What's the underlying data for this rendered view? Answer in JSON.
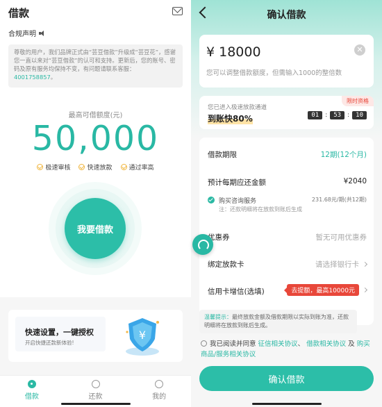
{
  "left": {
    "title": "借款",
    "compliance_label": "合规声明",
    "notice_text": "尊敬的用户，我们品牌正式由“芸豆借款”升级成“芸豆花”，感谢您一直以来对“芸豆借款”的认可和支持。更新后，您的账号、密码及原有服务均保持不变，有问题请联系客服：",
    "notice_phone": "4001758857",
    "notice_end": "。",
    "max_limit_label": "最高可借额度(元)",
    "max_limit_amount": "50,000",
    "features": [
      "极速审核",
      "快速放款",
      "通过率高"
    ],
    "borrow_button": "我要借款",
    "promo_title": "快速设置，一键授权",
    "promo_subtitle": "开启快捷还款新体验!",
    "tabs": [
      "借款",
      "还款",
      "我的"
    ]
  },
  "right": {
    "title": "确认借款",
    "amount": "¥ 18000",
    "amount_hint": "您可以调整借款额度，但需输入1000的整倍数",
    "limited_badge": "限时资格",
    "channel_text": "您已进入极速放款通道",
    "fast_text": "到账快80%",
    "timer": [
      "01",
      "53",
      "10"
    ],
    "term_label": "借款期限",
    "term_value": "12期(12个月)",
    "repay_label": "预计每期应还金额",
    "repay_value": "¥2040",
    "consult_label": "购买咨询服务",
    "consult_value": "231.68元/期(共12期)",
    "consult_note": "注：还款明细将在放款到账后生成",
    "coupon_label": "优惠券",
    "coupon_value": "暂无可用优惠券",
    "card_label": "绑定放款卡",
    "card_value": "请选择银行卡",
    "credit_label": "信用卡增信(选填)",
    "credit_tag": "去提额，最高10000元",
    "warm_label": "温馨提示：",
    "warm_text": "最终放款金额及借款期限以实际到账为准，还款明细将在放款到账后生成。",
    "agree_prefix": "我已阅读并同意",
    "agree_link1": "征信相关协议",
    "agree_sep": "、",
    "agree_link2": "借款相关协议",
    "agree_and": "及",
    "agree_link3": "购买商品/服务相关协议",
    "confirm_button": "确认借款"
  },
  "colors": {
    "accent": "#2cbea8",
    "warning": "#e8473a"
  }
}
